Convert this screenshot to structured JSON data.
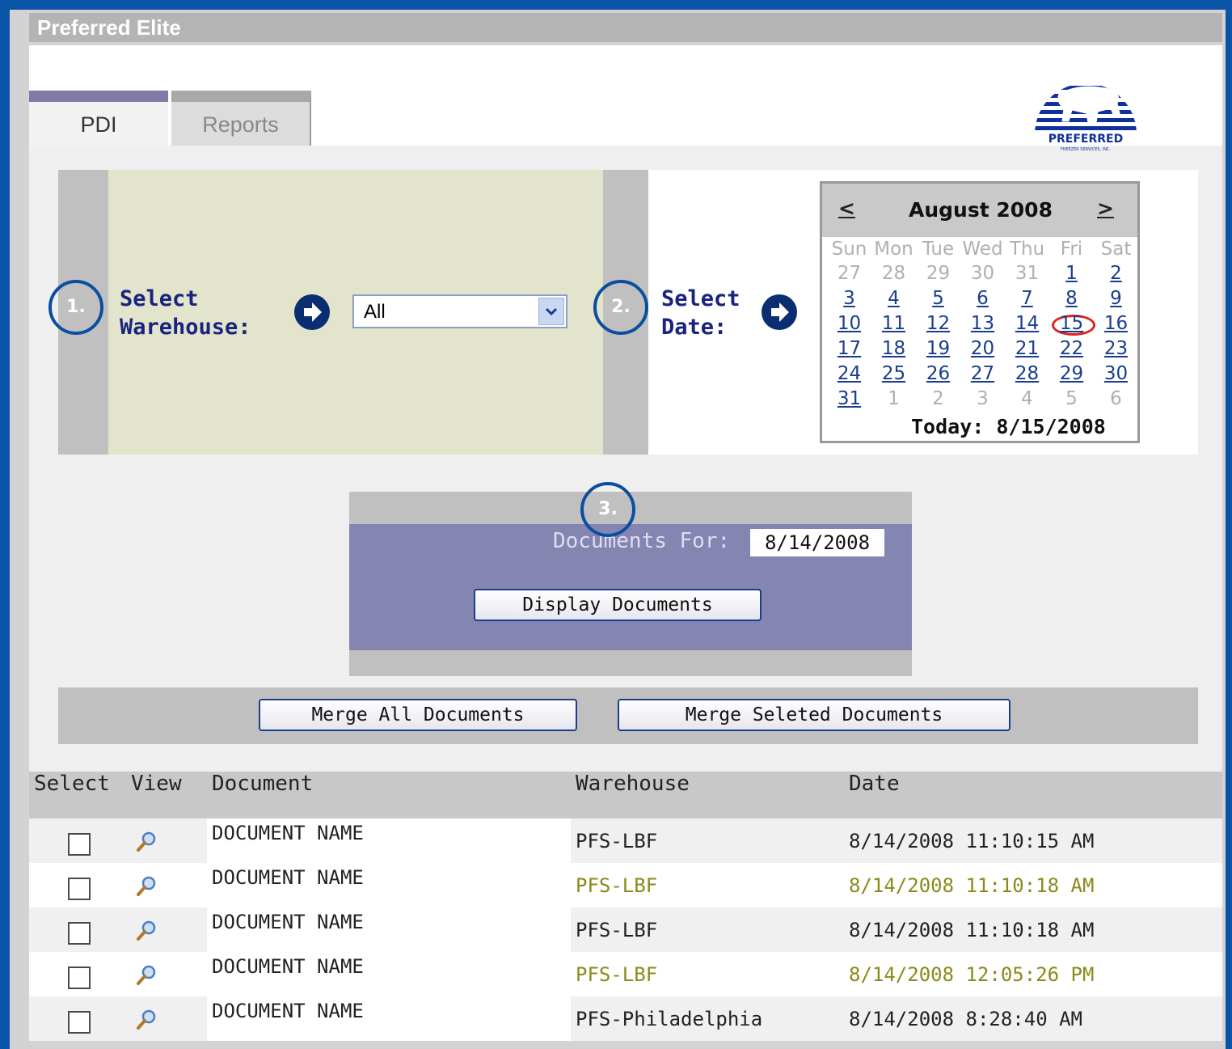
{
  "window": {
    "title": "Preferred Elite"
  },
  "tabs": [
    {
      "label": "PDI"
    },
    {
      "label": "Reports"
    }
  ],
  "logo": {
    "text": "PREFERRED",
    "subtext": "FREEZER SERVICES, INC."
  },
  "step1": {
    "number": "1.",
    "label_line1": "Select",
    "label_line2": "Warehouse:",
    "select_value": "All"
  },
  "step2": {
    "number": "2.",
    "label_line1": "Select",
    "label_line2": "Date:"
  },
  "calendar": {
    "prev": "<",
    "next": ">",
    "month_label": "August 2008",
    "dow": [
      "Sun",
      "Mon",
      "Tue",
      "Wed",
      "Thu",
      "Fri",
      "Sat"
    ],
    "weeks": [
      [
        "27",
        "28",
        "29",
        "30",
        "31",
        "1",
        "2"
      ],
      [
        "3",
        "4",
        "5",
        "6",
        "7",
        "8",
        "9"
      ],
      [
        "10",
        "11",
        "12",
        "13",
        "14",
        "15",
        "16"
      ],
      [
        "17",
        "18",
        "19",
        "20",
        "21",
        "22",
        "23"
      ],
      [
        "24",
        "25",
        "26",
        "27",
        "28",
        "29",
        "30"
      ],
      [
        "31",
        "1",
        "2",
        "3",
        "4",
        "5",
        "6"
      ]
    ],
    "today_label": "Today: 8/15/2008"
  },
  "step3": {
    "number": "3.",
    "documents_for_label": "Documents For:",
    "documents_for_value": "8/14/2008",
    "display_button": "Display Documents"
  },
  "merge": {
    "merge_all": "Merge All Documents",
    "merge_selected": "Merge Seleted Documents"
  },
  "table": {
    "headers": [
      "Select",
      "View",
      "Document",
      "Warehouse",
      "Date"
    ],
    "rows": [
      {
        "document": "DOCUMENT NAME",
        "warehouse": "PFS-LBF",
        "date": "8/14/2008 11:10:15 AM"
      },
      {
        "document": "DOCUMENT NAME",
        "warehouse": "PFS-LBF",
        "date": "8/14/2008 11:10:18 AM"
      },
      {
        "document": "DOCUMENT NAME",
        "warehouse": "PFS-LBF",
        "date": "8/14/2008 11:10:18 AM"
      },
      {
        "document": "DOCUMENT NAME",
        "warehouse": "PFS-LBF",
        "date": "8/14/2008 12:05:26 PM"
      },
      {
        "document": "DOCUMENT NAME",
        "warehouse": "PFS-Philadelphia",
        "date": "8/14/2008 8:28:40 AM"
      }
    ]
  },
  "colors": {
    "border_blue": "#0b55a8",
    "step_label": "#1a237e",
    "highlight_text": "#8a8a1a",
    "today_circle": "#e02020"
  }
}
